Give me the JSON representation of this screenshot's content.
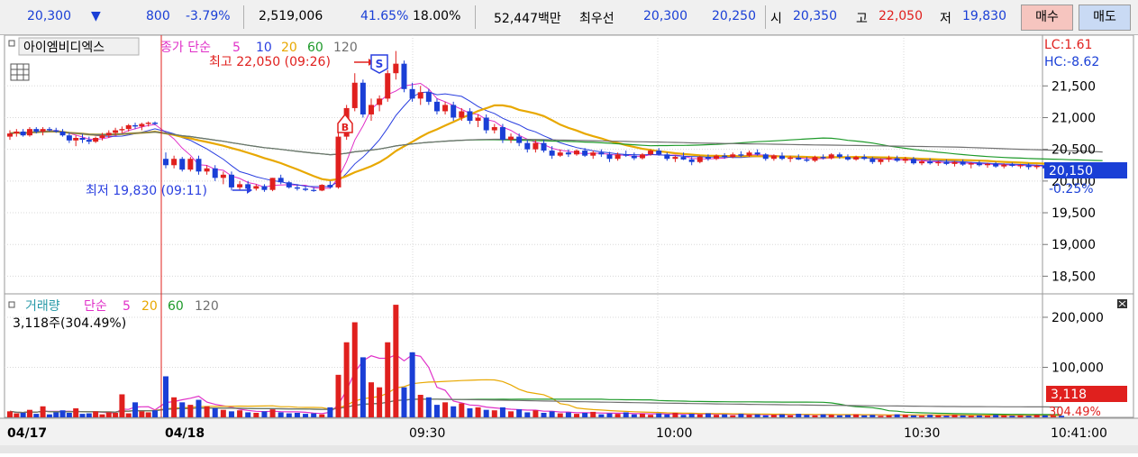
{
  "quote": {
    "price": "20,300",
    "down_arrow": "▼",
    "change": "800",
    "change_pct": "-3.79%",
    "volume": "2,519,006",
    "turnover_pct": "41.65%",
    "margin_pct": "18.00%",
    "amount": "52,447백만",
    "best_label": "최우선",
    "best_ask": "20,300",
    "best_bid": "20,250",
    "open_label": "시",
    "open": "20,350",
    "high_label": "고",
    "high": "22,050",
    "low_label": "저",
    "low": "19,830"
  },
  "buttons": {
    "buy": "매수",
    "sell": "매도"
  },
  "colors": {
    "up": "#e0201e",
    "down": "#1a3fd6",
    "ma5": "#e030c8",
    "ma10": "#2a3fe0",
    "ma20": "#e8a800",
    "ma60": "#1e9a2a",
    "ma120": "#707070",
    "current": "#1a3fd6",
    "volume_badge": "#e0201e"
  },
  "price_panel": {
    "stock_name": "아이엠비디엑스",
    "legend_prefix": "종가 단순",
    "legend_periods": [
      "5",
      "10",
      "20",
      "60",
      "120"
    ],
    "lc": "LC:1.61",
    "hc": "HC:-8.62",
    "high_annotation": "최고 22,050 (09:26)",
    "low_annotation": "최저 19,830 (09:11)",
    "sell_marker": "S",
    "buy_marker": "B",
    "current_price": "20,150",
    "current_pct": "-0.25%",
    "y_ticks": [
      "21,500",
      "21,000",
      "20,500",
      "20,000",
      "19,500",
      "19,000",
      "18,500"
    ]
  },
  "volume_panel": {
    "legend_label": "거래량",
    "legend_prefix": "단순",
    "legend_periods": [
      "5",
      "20",
      "60",
      "120"
    ],
    "last_volume": "3,118주(304.49%)",
    "current_volume": "3,118",
    "current_pct": "304.49%",
    "y_ticks": [
      "200,000",
      "100,000"
    ]
  },
  "x_axis": {
    "labels": [
      "04/17",
      "04/18",
      "09:30",
      "10:00",
      "10:30"
    ],
    "corner_time": "10:41:00"
  },
  "chart_data": {
    "type": "candlestick",
    "interval_minutes": 1,
    "price_ylim": [
      18250,
      22300
    ],
    "volume_ylim": [
      0,
      245000
    ],
    "grid": true,
    "candles_04_17": [
      [
        20700,
        20800,
        20650,
        20750
      ],
      [
        20750,
        20820,
        20700,
        20780
      ],
      [
        20780,
        20820,
        20700,
        20720
      ],
      [
        20720,
        20850,
        20700,
        20820
      ],
      [
        20820,
        20850,
        20750,
        20780
      ],
      [
        20780,
        20850,
        20720,
        20820
      ],
      [
        20820,
        20850,
        20780,
        20800
      ],
      [
        20800,
        20840,
        20760,
        20780
      ],
      [
        20780,
        20820,
        20700,
        20720
      ],
      [
        20720,
        20760,
        20600,
        20640
      ],
      [
        20640,
        20720,
        20550,
        20680
      ],
      [
        20680,
        20740,
        20600,
        20650
      ],
      [
        20650,
        20700,
        20580,
        20620
      ],
      [
        20620,
        20700,
        20600,
        20680
      ],
      [
        20680,
        20760,
        20640,
        20720
      ],
      [
        20720,
        20800,
        20680,
        20760
      ],
      [
        20760,
        20840,
        20720,
        20800
      ],
      [
        20800,
        20860,
        20760,
        20820
      ],
      [
        20820,
        20900,
        20780,
        20880
      ],
      [
        20880,
        20920,
        20820,
        20860
      ],
      [
        20860,
        20920,
        20800,
        20900
      ],
      [
        20900,
        20940,
        20860,
        20920
      ],
      [
        20920,
        20940,
        20880,
        20900
      ]
    ],
    "candles_04_18": [
      [
        20350,
        20450,
        20200,
        20250
      ],
      [
        20250,
        20400,
        20200,
        20350
      ],
      [
        20350,
        20380,
        20150,
        20180
      ],
      [
        20180,
        20380,
        20150,
        20350
      ],
      [
        20350,
        20400,
        20100,
        20150
      ],
      [
        20150,
        20250,
        20100,
        20200
      ],
      [
        20200,
        20250,
        20000,
        20050
      ],
      [
        20050,
        20150,
        19950,
        20100
      ],
      [
        20100,
        20150,
        19850,
        19900
      ],
      [
        19900,
        20000,
        19850,
        19950
      ],
      [
        19950,
        20000,
        19850,
        19880
      ],
      [
        19880,
        19950,
        19850,
        19920
      ],
      [
        19920,
        19950,
        19830,
        19860
      ],
      [
        19860,
        20050,
        19840,
        20050
      ],
      [
        20050,
        20100,
        19950,
        19980
      ],
      [
        19980,
        20000,
        19880,
        19900
      ],
      [
        19900,
        19950,
        19850,
        19880
      ],
      [
        19880,
        19920,
        19840,
        19860
      ],
      [
        19860,
        19900,
        19830,
        19850
      ],
      [
        19850,
        19950,
        19840,
        19940
      ],
      [
        19940,
        20000,
        19880,
        19900
      ],
      [
        19900,
        20800,
        19880,
        20700
      ],
      [
        20700,
        21200,
        20650,
        21150
      ],
      [
        21150,
        21700,
        21100,
        21550
      ],
      [
        21550,
        21600,
        21000,
        21050
      ],
      [
        21050,
        21300,
        20950,
        21200
      ],
      [
        21200,
        21350,
        21100,
        21300
      ],
      [
        21300,
        21750,
        21250,
        21700
      ],
      [
        21700,
        22050,
        21600,
        21850
      ],
      [
        21850,
        21900,
        21400,
        21450
      ],
      [
        21450,
        21550,
        21250,
        21300
      ],
      [
        21300,
        21500,
        21200,
        21400
      ],
      [
        21400,
        21450,
        21200,
        21250
      ],
      [
        21250,
        21300,
        21050,
        21100
      ],
      [
        21100,
        21250,
        21050,
        21200
      ],
      [
        21200,
        21250,
        20950,
        21000
      ],
      [
        21000,
        21150,
        20950,
        21100
      ],
      [
        21100,
        21150,
        20900,
        20950
      ],
      [
        20950,
        21050,
        20850,
        21000
      ],
      [
        21000,
        21050,
        20750,
        20800
      ],
      [
        20800,
        20900,
        20750,
        20850
      ],
      [
        20850,
        20900,
        20600,
        20650
      ],
      [
        20650,
        20750,
        20600,
        20700
      ],
      [
        20700,
        20750,
        20550,
        20600
      ],
      [
        20600,
        20650,
        20450,
        20500
      ],
      [
        20500,
        20650,
        20450,
        20600
      ],
      [
        20600,
        20650,
        20450,
        20480
      ],
      [
        20480,
        20550,
        20350,
        20400
      ],
      [
        20400,
        20500,
        20380,
        20450
      ],
      [
        20450,
        20500,
        20380,
        20420
      ],
      [
        20420,
        20500,
        20400,
        20480
      ],
      [
        20480,
        20520,
        20380,
        20400
      ],
      [
        20400,
        20480,
        20350,
        20450
      ],
      [
        20450,
        20500,
        20380,
        20420
      ],
      [
        20420,
        20460,
        20300,
        20350
      ],
      [
        20350,
        20450,
        20320,
        20420
      ],
      [
        20420,
        20480,
        20380,
        20400
      ],
      [
        20400,
        20450,
        20330,
        20360
      ],
      [
        20360,
        20440,
        20340,
        20420
      ],
      [
        20420,
        20500,
        20400,
        20480
      ],
      [
        20480,
        20520,
        20400,
        20420
      ],
      [
        20420,
        20450,
        20320,
        20350
      ],
      [
        20350,
        20400,
        20300,
        20380
      ],
      [
        20380,
        20450,
        20330,
        20340
      ],
      [
        20340,
        20380,
        20250,
        20300
      ],
      [
        20300,
        20400,
        20280,
        20380
      ],
      [
        20380,
        20420,
        20320,
        20350
      ],
      [
        20350,
        20420,
        20330,
        20400
      ],
      [
        20400,
        20440,
        20350,
        20380
      ],
      [
        20380,
        20450,
        20360,
        20420
      ],
      [
        20420,
        20470,
        20380,
        20400
      ],
      [
        20400,
        20480,
        20380,
        20450
      ],
      [
        20450,
        20500,
        20400,
        20420
      ],
      [
        20420,
        20440,
        20320,
        20350
      ],
      [
        20350,
        20420,
        20320,
        20400
      ],
      [
        20400,
        20450,
        20330,
        20350
      ],
      [
        20350,
        20400,
        20300,
        20370
      ],
      [
        20370,
        20420,
        20330,
        20340
      ],
      [
        20340,
        20380,
        20300,
        20320
      ],
      [
        20320,
        20400,
        20300,
        20380
      ],
      [
        20380,
        20420,
        20340,
        20360
      ],
      [
        20360,
        20440,
        20340,
        20420
      ],
      [
        20420,
        20450,
        20350,
        20380
      ],
      [
        20380,
        20420,
        20320,
        20340
      ],
      [
        20340,
        20400,
        20320,
        20380
      ],
      [
        20380,
        20420,
        20330,
        20350
      ],
      [
        20350,
        20380,
        20270,
        20300
      ],
      [
        20300,
        20360,
        20260,
        20340
      ],
      [
        20340,
        20400,
        20300,
        20360
      ],
      [
        20360,
        20400,
        20300,
        20320
      ],
      [
        20320,
        20380,
        20280,
        20350
      ],
      [
        20350,
        20380,
        20260,
        20280
      ],
      [
        20280,
        20340,
        20250,
        20310
      ],
      [
        20310,
        20360,
        20260,
        20280
      ],
      [
        20280,
        20320,
        20240,
        20300
      ],
      [
        20300,
        20340,
        20250,
        20270
      ],
      [
        20270,
        20320,
        20230,
        20300
      ],
      [
        20300,
        20340,
        20240,
        20260
      ],
      [
        20260,
        20300,
        20200,
        20280
      ],
      [
        20280,
        20320,
        20230,
        20250
      ],
      [
        20250,
        20290,
        20210,
        20270
      ],
      [
        20270,
        20300,
        20210,
        20230
      ],
      [
        20230,
        20280,
        20200,
        20260
      ],
      [
        20260,
        20290,
        20220,
        20240
      ],
      [
        20240,
        20270,
        20200,
        20250
      ],
      [
        20250,
        20280,
        20180,
        20220
      ],
      [
        20220,
        20260,
        20190,
        20240
      ],
      [
        20240,
        20260,
        20180,
        20200
      ],
      [
        20200,
        20250,
        20170,
        20230
      ],
      [
        20230,
        20260,
        20200,
        20220
      ],
      [
        20220,
        20250,
        20180,
        20200
      ],
      [
        20200,
        20240,
        20170,
        20210
      ],
      [
        20210,
        20240,
        20150,
        20170
      ],
      [
        20170,
        20230,
        20150,
        20200
      ],
      [
        20200,
        20230,
        20130,
        20150
      ]
    ],
    "volumes_04_17": [
      12000,
      8000,
      9000,
      15000,
      7000,
      22000,
      6000,
      10000,
      14000,
      9000,
      18000,
      7000,
      8000,
      12000,
      6000,
      10000,
      9000,
      46000,
      8000,
      30000,
      12000,
      10000,
      14000
    ],
    "volumes_04_18": [
      82000,
      40000,
      30000,
      25000,
      35000,
      22000,
      18000,
      15000,
      12000,
      14000,
      10000,
      9000,
      12000,
      16000,
      10000,
      8000,
      9000,
      7000,
      8000,
      6000,
      20000,
      85000,
      150000,
      190000,
      120000,
      70000,
      60000,
      150000,
      225000,
      60000,
      130000,
      45000,
      40000,
      25000,
      30000,
      22000,
      28000,
      18000,
      20000,
      15000,
      14000,
      20000,
      12000,
      16000,
      10000,
      14000,
      9000,
      12000,
      8000,
      10000,
      7000,
      9000,
      11000,
      6000,
      8000,
      7000,
      10000,
      6000,
      7000,
      5000,
      8000,
      6000,
      9000,
      5000,
      7000,
      6000,
      8000,
      5000,
      6000,
      4000,
      7000,
      5000,
      6000,
      4000,
      5000,
      6000,
      4000,
      7000,
      5000,
      4000,
      6000,
      5000,
      4000,
      5000,
      6000,
      4000,
      5000,
      3000,
      4000,
      6000,
      5000,
      4000,
      3000,
      5000,
      4000,
      3000,
      5000,
      4000,
      3000,
      4000,
      3000,
      5000,
      4000,
      3000,
      4000,
      3000,
      5000,
      4000,
      3000,
      3118
    ],
    "ma_periods": [
      5,
      10,
      20,
      60,
      120
    ]
  }
}
